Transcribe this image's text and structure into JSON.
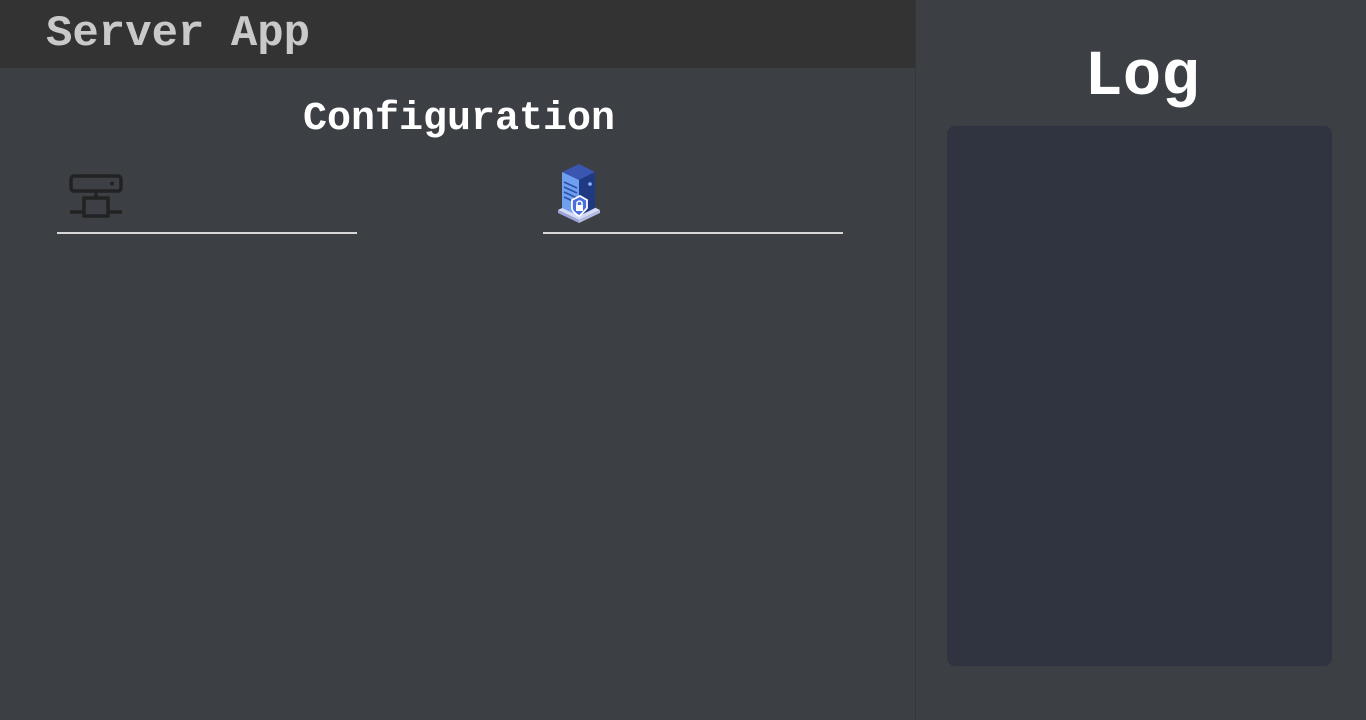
{
  "header": {
    "app_title": "Server App"
  },
  "config": {
    "title": "Configuration",
    "fields": [
      {
        "icon": "network-server-icon",
        "value": ""
      },
      {
        "icon": "secure-server-icon",
        "value": ""
      }
    ]
  },
  "log": {
    "title": "Log",
    "content": ""
  },
  "colors": {
    "background": "#3c3f43",
    "titlebar": "#333333",
    "log_panel": "#2f3440",
    "server_icon_blue": "#5b8def",
    "underline": "#d8d8d8"
  }
}
